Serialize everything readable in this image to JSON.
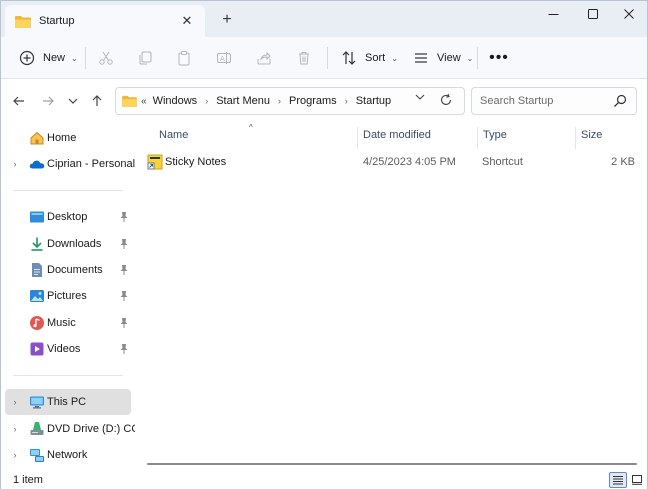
{
  "tab": {
    "title": "Startup",
    "close_glyph": "✕",
    "new_tab_glyph": "+"
  },
  "window_controls": {
    "minimize": "—",
    "maximize": "☐",
    "close": "✕"
  },
  "commandbar": {
    "new_label": "New",
    "sort_label": "Sort",
    "view_label": "View",
    "more_glyph": "•••",
    "chevron": "⌄"
  },
  "address": {
    "overflow": "«",
    "crumbs": [
      "Windows",
      "Start Menu",
      "Programs",
      "Startup"
    ],
    "separator": "›",
    "dropdown_glyph": "⌄"
  },
  "search": {
    "placeholder": "Search Startup"
  },
  "sidebar": {
    "items": [
      {
        "label": "Home",
        "icon": "home-icon"
      },
      {
        "label": "Ciprian - Personal",
        "icon": "onedrive-icon"
      },
      {
        "label": "Desktop",
        "icon": "desktop-icon",
        "pinned": true
      },
      {
        "label": "Downloads",
        "icon": "downloads-icon",
        "pinned": true
      },
      {
        "label": "Documents",
        "icon": "documents-icon",
        "pinned": true
      },
      {
        "label": "Pictures",
        "icon": "pictures-icon",
        "pinned": true
      },
      {
        "label": "Music",
        "icon": "music-icon",
        "pinned": true
      },
      {
        "label": "Videos",
        "icon": "videos-icon",
        "pinned": true
      },
      {
        "label": "This PC",
        "icon": "this-pc-icon",
        "selected": true
      },
      {
        "label": "DVD Drive (D:) CCC",
        "icon": "dvd-drive-icon"
      },
      {
        "label": "Network",
        "icon": "network-icon"
      }
    ],
    "expand_glyph": "›"
  },
  "columns": {
    "name": "Name",
    "date": "Date modified",
    "type": "Type",
    "size": "Size",
    "sort_glyph": "^"
  },
  "files": [
    {
      "name": "Sticky Notes",
      "date": "4/25/2023 4:05 PM",
      "type": "Shortcut",
      "size": "2 KB",
      "icon": "sticky-notes-shortcut-icon"
    }
  ],
  "status": {
    "item_count": "1 item"
  },
  "colors": {
    "accent": "#0067c0",
    "folder": "#f8c846",
    "selected_nav": "#e0e0e0",
    "header_text": "#3b4b66"
  }
}
